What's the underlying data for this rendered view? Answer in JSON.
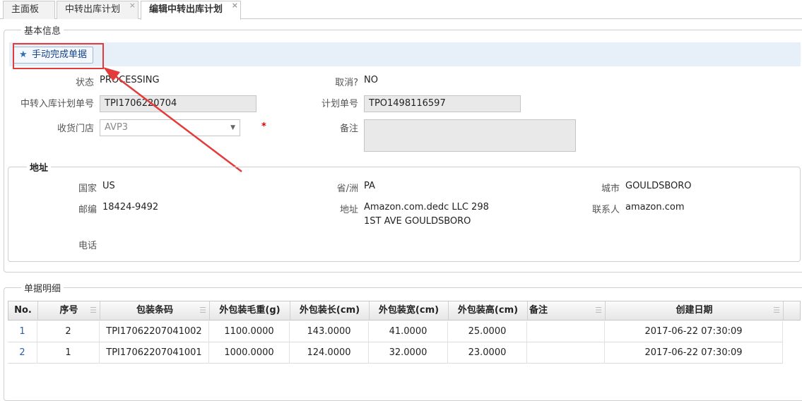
{
  "tabs": [
    {
      "label": "主面板",
      "closable": false,
      "active": false
    },
    {
      "label": "中转出库计划",
      "closable": true,
      "active": false
    },
    {
      "label": "编辑中转出库计划",
      "closable": true,
      "active": true
    }
  ],
  "close_glyph": "×",
  "basic": {
    "legend": "基本信息",
    "action_button": "手动完成单据",
    "status_label": "状态",
    "status_value": "PROCESSING",
    "cancelled_label": "取消?",
    "cancelled_value": "NO",
    "inbound_plan_label": "中转入库计划单号",
    "inbound_plan_value": "TPI1706220704",
    "plan_no_label": "计划单号",
    "plan_no_value": "TPO1498116597",
    "store_label": "收货门店",
    "store_value": "AVP3",
    "required_mark": "*",
    "remark_label": "备注",
    "remark_value": ""
  },
  "address": {
    "legend": "地址",
    "country_label": "国家",
    "country_value": "US",
    "state_label": "省/洲",
    "state_value": "PA",
    "city_label": "城市",
    "city_value": "GOULDSBORO",
    "zip_label": "邮编",
    "zip_value": "18424-9492",
    "addr_label": "地址",
    "addr_line1": "Amazon.com.dedc LLC 298",
    "addr_line2": "1ST AVE GOULDSBORO",
    "contact_label": "联系人",
    "contact_value": "amazon.com",
    "phone_label": "电话",
    "phone_value": ""
  },
  "detail": {
    "legend": "单据明细",
    "columns": [
      "No.",
      "序号",
      "包装条码",
      "外包装毛重(g)",
      "外包装长(cm)",
      "外包装宽(cm)",
      "外包装高(cm)",
      "备注",
      "创建日期"
    ],
    "rows": [
      [
        "1",
        "2",
        "TPI17062207041002",
        "1100.0000",
        "143.0000",
        "41.0000",
        "25.0000",
        "",
        "2017-06-22 07:30:09"
      ],
      [
        "2",
        "1",
        "TPI17062207041001",
        "1000.0000",
        "124.0000",
        "32.0000",
        "23.0000",
        "",
        "2017-06-22 07:30:09"
      ]
    ]
  },
  "colors": {
    "accent": "#2f6fb5",
    "annotation": "#e33b3b",
    "toolbar_bg": "#e7eff8"
  }
}
